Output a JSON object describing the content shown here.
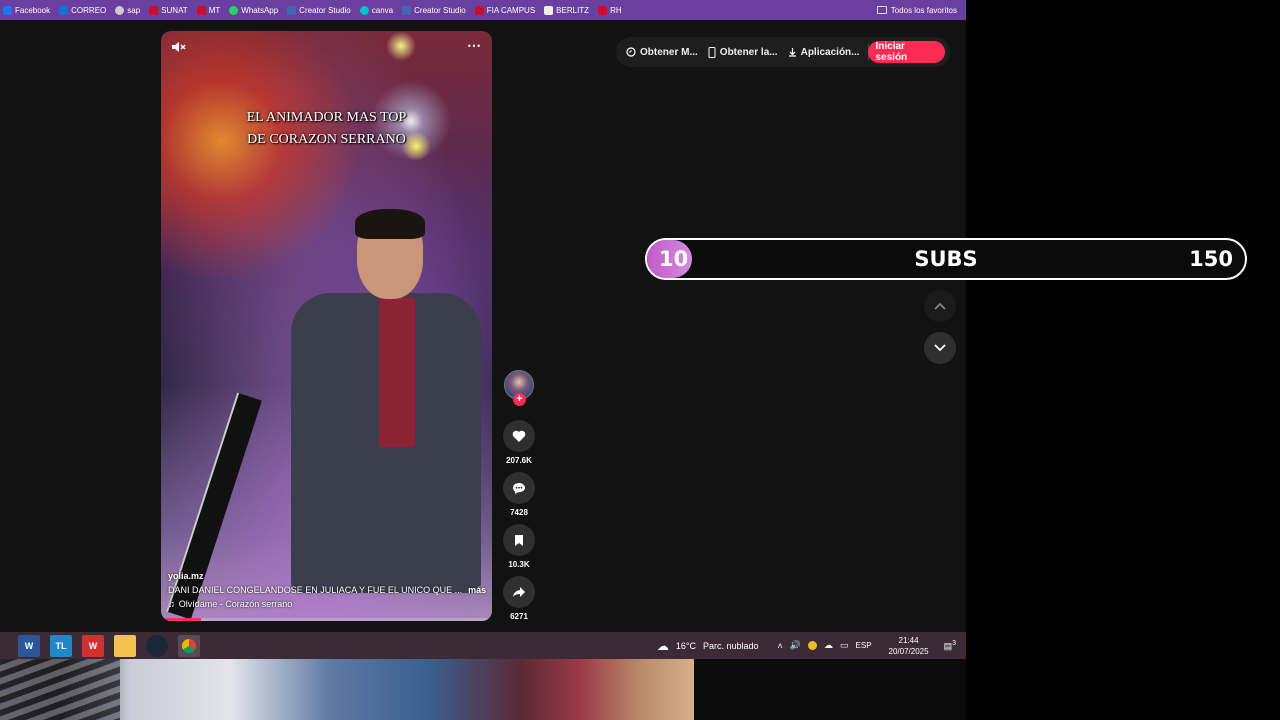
{
  "bookmarks": [
    {
      "label": "Facebook",
      "color": "#1877f2"
    },
    {
      "label": "CORREO",
      "color": "#0078d4"
    },
    {
      "label": "sap",
      "color": "#cccccc"
    },
    {
      "label": "SUNAT",
      "color": "#c8102e"
    },
    {
      "label": "MT",
      "color": "#c8102e"
    },
    {
      "label": "WhatsApp",
      "color": "#25d366"
    },
    {
      "label": "Creator Studio",
      "color": "#4267b2"
    },
    {
      "label": "canva",
      "color": "#00c4cc"
    },
    {
      "label": "Creator Studio",
      "color": "#4267b2"
    },
    {
      "label": "FIA CAMPUS",
      "color": "#c8102e"
    },
    {
      "label": "BERLITZ",
      "color": "#eeeeee"
    },
    {
      "label": "RH",
      "color": "#c8102e"
    }
  ],
  "bookmarks_folder": "Todos los favoritos",
  "video": {
    "overlay_line1": "EL ANIMADOR MAS TOP",
    "overlay_line2": "DE CORAZON SERRANO",
    "username": "yolia.mz",
    "caption": "DANI DANIEL CONGELANDOSE EN JULIACA Y FUE EL UNICO QUE ...",
    "more_label": "más",
    "music": "Olvídame - Corazón serrano",
    "progress": 0.12
  },
  "actions": {
    "likes": "207.6K",
    "comments": "7428",
    "saves": "10.3K",
    "shares": "6271"
  },
  "header": {
    "item1": "Obtener M...",
    "item2": "Obtener la...",
    "item3": "Aplicación...",
    "login": "Iniciar sesión"
  },
  "subs": {
    "current": "10",
    "label": "SUBS",
    "goal": "150",
    "progress": 0.0667,
    "fill_color": "#c05bc7"
  },
  "taskbar": {
    "apps": [
      {
        "icon": "word-icon",
        "label": "W",
        "color": "#2b579a"
      },
      {
        "icon": "tl-icon",
        "label": "TL",
        "color": "#1e88c8"
      },
      {
        "icon": "wps-icon",
        "label": "W",
        "color": "#d32f2f"
      },
      {
        "icon": "folder-icon",
        "label": "",
        "color": "#f2c14e"
      },
      {
        "icon": "steam-icon",
        "label": "",
        "color": "#1b2838"
      },
      {
        "icon": "chrome-icon",
        "label": "",
        "color": "#444444"
      }
    ],
    "weather_temp": "16°C",
    "weather_desc": "Parc. nublado",
    "language": "ESP",
    "time": "21:44",
    "date": "20/07/2025",
    "notifications": "3"
  }
}
